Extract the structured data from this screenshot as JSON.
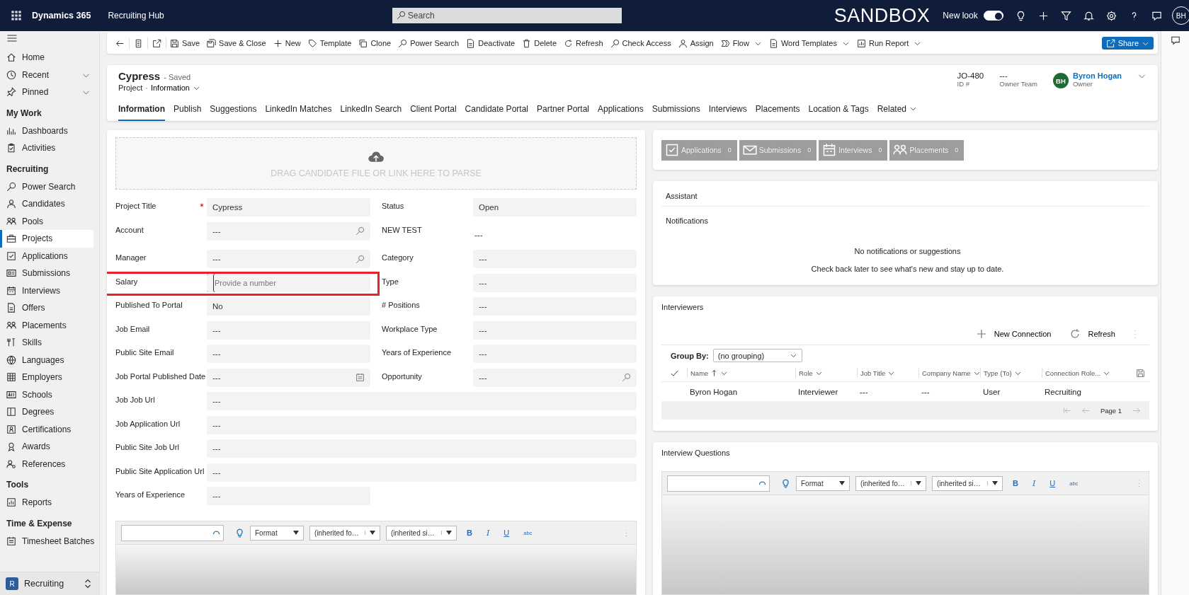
{
  "top_bar": {
    "app_name": "Dynamics 365",
    "area_name": "Recruiting Hub",
    "search": {
      "placeholder": "Search"
    },
    "environment": "SANDBOX",
    "new_look": {
      "label": "New look",
      "on": true
    },
    "avatar": "BH"
  },
  "sidebar": {
    "groups": [
      {
        "items": [
          {
            "label": "Home",
            "has_menu": false,
            "selected": false
          },
          {
            "label": "Recent",
            "has_menu": true,
            "selected": false
          },
          {
            "label": "Pinned",
            "has_menu": true,
            "selected": false
          }
        ]
      },
      {
        "title": "My Work",
        "items": [
          {
            "label": "Dashboards",
            "has_menu": false,
            "selected": false
          },
          {
            "label": "Activities",
            "has_menu": false,
            "selected": false
          }
        ]
      },
      {
        "title": "Recruiting",
        "items": [
          {
            "label": "Power Search",
            "has_menu": false,
            "selected": false
          },
          {
            "label": "Candidates",
            "has_menu": false,
            "selected": false
          },
          {
            "label": "Pools",
            "has_menu": false,
            "selected": false
          },
          {
            "label": "Projects",
            "has_menu": false,
            "selected": true
          },
          {
            "label": "Applications",
            "has_menu": false,
            "selected": false
          },
          {
            "label": "Submissions",
            "has_menu": false,
            "selected": false
          },
          {
            "label": "Interviews",
            "has_menu": false,
            "selected": false
          },
          {
            "label": "Offers",
            "has_menu": false,
            "selected": false
          },
          {
            "label": "Placements",
            "has_menu": false,
            "selected": false
          },
          {
            "label": "Skills",
            "has_menu": false,
            "selected": false
          },
          {
            "label": "Languages",
            "has_menu": false,
            "selected": false
          },
          {
            "label": "Employers",
            "has_menu": false,
            "selected": false
          },
          {
            "label": "Schools",
            "has_menu": false,
            "selected": false
          },
          {
            "label": "Degrees",
            "has_menu": false,
            "selected": false
          },
          {
            "label": "Certifications",
            "has_menu": false,
            "selected": false
          },
          {
            "label": "Awards",
            "has_menu": false,
            "selected": false
          },
          {
            "label": "References",
            "has_menu": false,
            "selected": false
          }
        ]
      },
      {
        "title": "Tools",
        "items": [
          {
            "label": "Reports",
            "has_menu": false,
            "selected": false
          }
        ]
      },
      {
        "title": "Time & Expense",
        "items": [
          {
            "label": "Timesheet Batches",
            "has_menu": false,
            "selected": false
          }
        ]
      }
    ],
    "area_switcher": {
      "badge": "R",
      "label": "Recruiting"
    }
  },
  "command_bar": {
    "commands": [
      {
        "label": "Save",
        "has_menu": false
      },
      {
        "label": "Save & Close",
        "has_menu": false
      },
      {
        "label": "New",
        "has_menu": false
      },
      {
        "label": "Template",
        "has_menu": false
      },
      {
        "label": "Clone",
        "has_menu": false
      },
      {
        "label": "Power Search",
        "has_menu": false
      },
      {
        "label": "Deactivate",
        "has_menu": false
      },
      {
        "label": "Delete",
        "has_menu": false
      },
      {
        "label": "Refresh",
        "has_menu": false
      },
      {
        "label": "Check Access",
        "has_menu": false
      },
      {
        "label": "Assign",
        "has_menu": false
      },
      {
        "label": "Flow",
        "has_menu": true
      },
      {
        "label": "Word Templates",
        "has_menu": true
      },
      {
        "label": "Run Report",
        "has_menu": true
      }
    ],
    "share": "Share"
  },
  "header": {
    "title": "Cypress",
    "save_status": "- Saved",
    "entity": "Project",
    "separator": "·",
    "form": "Information",
    "fields": [
      {
        "value": "JO-480",
        "label": "ID #"
      },
      {
        "value": "---",
        "label": "Owner Team"
      }
    ],
    "owner": {
      "initials": "BH",
      "name": "Byron Hogan",
      "label": "Owner"
    }
  },
  "tabs": [
    {
      "label": "Information",
      "selected": true,
      "has_menu": false
    },
    {
      "label": "Publish",
      "selected": false,
      "has_menu": false
    },
    {
      "label": "Suggestions",
      "selected": false,
      "has_menu": false
    },
    {
      "label": "LinkedIn Matches",
      "selected": false,
      "has_menu": false
    },
    {
      "label": "LinkedIn Search",
      "selected": false,
      "has_menu": false
    },
    {
      "label": "Client Portal",
      "selected": false,
      "has_menu": false
    },
    {
      "label": "Candidate Portal",
      "selected": false,
      "has_menu": false
    },
    {
      "label": "Partner Portal",
      "selected": false,
      "has_menu": false
    },
    {
      "label": "Applications",
      "selected": false,
      "has_menu": false
    },
    {
      "label": "Submissions",
      "selected": false,
      "has_menu": false
    },
    {
      "label": "Interviews",
      "selected": false,
      "has_menu": false
    },
    {
      "label": "Placements",
      "selected": false,
      "has_menu": false
    },
    {
      "label": "Location & Tags",
      "selected": false,
      "has_menu": false
    },
    {
      "label": "Related",
      "selected": false,
      "has_menu": true
    }
  ],
  "form": {
    "dropzone": "DRAG CANDIDATE FILE OR LINK HERE TO PARSE",
    "rows": [
      {
        "wide": false,
        "fields": [
          {
            "label": "Project Title",
            "kind": "text",
            "value": "Cypress",
            "required": true,
            "highlighted": false
          },
          {
            "label": "Status",
            "kind": "text",
            "value": "Open",
            "required": false,
            "highlighted": false
          }
        ]
      },
      {
        "wide": false,
        "fields": [
          {
            "label": "Account",
            "kind": "lookup",
            "value": "---",
            "required": false,
            "highlighted": false
          },
          {
            "label": "NEW TEST",
            "kind": "readonly",
            "value": "---",
            "required": false,
            "highlighted": false
          }
        ]
      },
      {
        "wide": false,
        "fields": [
          {
            "label": "Manager",
            "kind": "lookup",
            "value": "---",
            "required": false,
            "highlighted": false
          },
          {
            "label": "Category",
            "kind": "text",
            "value": "---",
            "required": false,
            "highlighted": false
          }
        ]
      },
      {
        "wide": false,
        "fields": [
          {
            "label": "Salary",
            "kind": "text",
            "placeholder": "Provide a number",
            "required": false,
            "highlighted": true
          },
          {
            "label": "Type",
            "kind": "text",
            "value": "---",
            "required": false,
            "highlighted": false
          }
        ]
      },
      {
        "wide": false,
        "fields": [
          {
            "label": "Published To Portal",
            "kind": "text",
            "value": "No",
            "required": false,
            "highlighted": false
          },
          {
            "label": "# Positions",
            "kind": "text",
            "value": "---",
            "required": false,
            "highlighted": false
          }
        ]
      },
      {
        "wide": false,
        "fields": [
          {
            "label": "Job Email",
            "kind": "text",
            "value": "---",
            "required": false,
            "highlighted": false
          },
          {
            "label": "Workplace Type",
            "kind": "text",
            "value": "---",
            "required": false,
            "highlighted": false
          }
        ]
      },
      {
        "wide": false,
        "fields": [
          {
            "label": "Public Site Email",
            "kind": "text",
            "value": "---",
            "required": false,
            "highlighted": false
          },
          {
            "label": "Years of Experience",
            "kind": "text",
            "value": "---",
            "required": false,
            "highlighted": false
          }
        ]
      },
      {
        "wide": false,
        "fields": [
          {
            "label": "Job Portal Published Date",
            "kind": "date",
            "value": "---",
            "required": false,
            "highlighted": false
          },
          {
            "label": "Opportunity",
            "kind": "lookup",
            "value": "---",
            "required": false,
            "highlighted": false
          }
        ]
      },
      {
        "wide": true,
        "fields": [
          {
            "label": "Job Job Url",
            "kind": "text",
            "value": "---",
            "required": false,
            "highlighted": false
          }
        ]
      },
      {
        "wide": true,
        "fields": [
          {
            "label": "Job Application Url",
            "kind": "text",
            "value": "---",
            "required": false,
            "highlighted": false
          }
        ]
      },
      {
        "wide": true,
        "fields": [
          {
            "label": "Public Site Job Url",
            "kind": "text",
            "value": "---",
            "required": false,
            "highlighted": false
          }
        ]
      },
      {
        "wide": true,
        "fields": [
          {
            "label": "Public Site Application Url",
            "kind": "text",
            "value": "---",
            "required": false,
            "highlighted": false
          }
        ]
      },
      {
        "wide": false,
        "fields": [
          {
            "label": "Years of Experience",
            "kind": "text",
            "value": "---",
            "required": false,
            "highlighted": false
          }
        ]
      }
    ],
    "editor": {
      "format": "Format",
      "font": "(inherited fo…",
      "size": "(inherited si…",
      "buttons": [
        "B",
        "I",
        "U",
        "abc"
      ]
    }
  },
  "summary_buttons": [
    {
      "label": "Applications",
      "count": "0"
    },
    {
      "label": "Submissions",
      "count": "0"
    },
    {
      "label": "Interviews",
      "count": "0"
    },
    {
      "label": "Placements",
      "count": "0"
    }
  ],
  "assistant": {
    "title": "Assistant",
    "section": "Notifications",
    "message": "No notifications or suggestions",
    "hint": "Check back later to see what's new and stay up to date."
  },
  "interviewers": {
    "title": "Interviewers",
    "commands": [
      "New Connection",
      "Refresh"
    ],
    "group_by": {
      "label": "Group By:",
      "value": "(no grouping)"
    },
    "columns": [
      {
        "label": "Name",
        "sorted": true
      },
      {
        "label": "Role",
        "sorted": false
      },
      {
        "label": "Job Title",
        "sorted": false
      },
      {
        "label": "Company Name",
        "sorted": false
      },
      {
        "label": "Type (To)",
        "sorted": false
      },
      {
        "label": "Connection Role...",
        "sorted": false
      }
    ],
    "rows": [
      [
        "Byron Hogan",
        "Interviewer",
        "---",
        "---",
        "User",
        "Recruiting"
      ]
    ],
    "pager": "Page 1"
  },
  "interview_questions": {
    "title": "Interview Questions",
    "editor": {
      "format": "Format",
      "font": "(inherited fo…",
      "size": "(inherited si…",
      "buttons": [
        "B",
        "I",
        "U",
        "abc"
      ]
    }
  }
}
